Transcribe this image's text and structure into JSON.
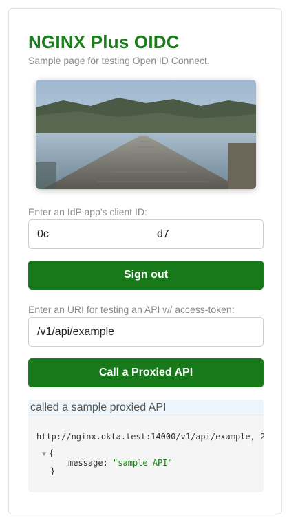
{
  "header": {
    "title": "NGINX Plus OIDC",
    "subtitle": "Sample page for testing Open ID Connect."
  },
  "client": {
    "label": "Enter an IdP app's client ID:",
    "value_start": "0c",
    "value_end": "d7"
  },
  "signout": {
    "label": "Sign out"
  },
  "api": {
    "label": "Enter an URI for testing an API w/ access-token:",
    "value": "/v1/api/example"
  },
  "call_button": {
    "label": "Call a Proxied API"
  },
  "result": {
    "header": "called a sample proxied API",
    "url_line": "http://nginx.okta.test:14000/v1/api/example, 2",
    "open_brace": "{",
    "key": "message:",
    "value": "\"sample API\"",
    "close_brace": "}"
  },
  "colors": {
    "brand_green": "#1a7f1a",
    "button_green": "#17791a"
  }
}
